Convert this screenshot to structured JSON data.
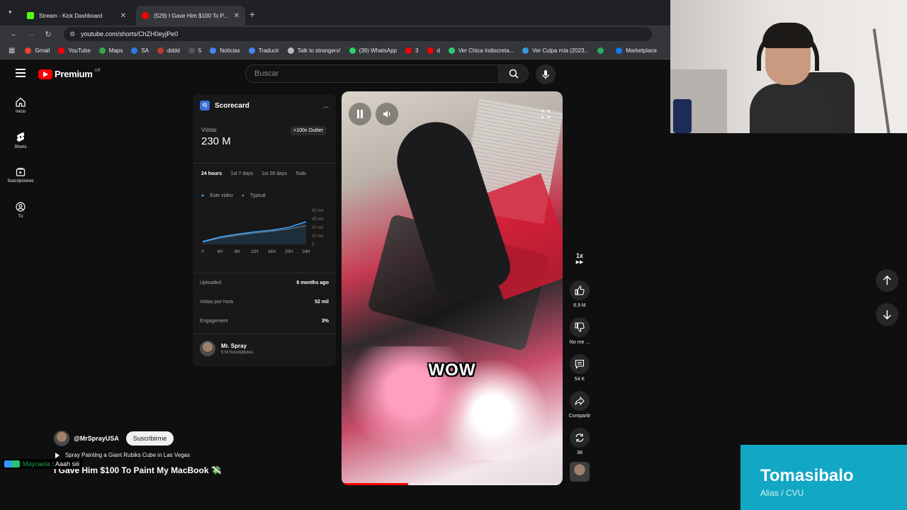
{
  "browser": {
    "tabs": [
      {
        "title": "Stream - Kick Dashboard",
        "favicon_color": "#53fc18",
        "active": false
      },
      {
        "title": "(529) I Gave Him $100 To P...",
        "favicon_color": "#ff0000",
        "active": true
      }
    ],
    "url": "youtube.com/shorts/ChZH0eyjPe0",
    "bookmarks": [
      {
        "label": "Gmail",
        "color": "#ea4335"
      },
      {
        "label": "YouTube",
        "color": "#ff0000"
      },
      {
        "label": "Maps",
        "color": "#34a853"
      },
      {
        "label": "SA",
        "color": "#2c7be5"
      },
      {
        "label": "dddd",
        "color": "#c0392b"
      },
      {
        "label": "5",
        "color": "#555555"
      },
      {
        "label": "Noticias",
        "color": "#4285f4"
      },
      {
        "label": "Traducir",
        "color": "#4285f4"
      },
      {
        "label": "Talk to strangers!",
        "color": "#bbbbbb"
      },
      {
        "label": "(39) WhatsApp",
        "color": "#25d366"
      },
      {
        "label": "3",
        "color": "#ff0000"
      },
      {
        "label": "d",
        "color": "#ff0000"
      },
      {
        "label": "Ver Chica Indiscreta...",
        "color": "#2ecc71"
      },
      {
        "label": "Ver Culpa mía (2023...",
        "color": "#3498db"
      },
      {
        "label": "",
        "color": "#27ae60"
      },
      {
        "label": "Marketplace",
        "color": "#1877f2"
      }
    ]
  },
  "youtube": {
    "logo_text": "Premium",
    "country_code": "AR",
    "search_placeholder": "Buscar",
    "rail": [
      {
        "label": "Inicio",
        "icon": "home-icon"
      },
      {
        "label": "Shorts",
        "icon": "shorts-icon"
      },
      {
        "label": "Suscripciones",
        "icon": "subscriptions-icon"
      },
      {
        "label": "Tú",
        "icon": "you-icon"
      }
    ]
  },
  "scorecard": {
    "badge": "IQ",
    "title": "Scorecard",
    "views_label": "Vistas",
    "views": "230 M",
    "outlier": ">100x Outlier",
    "ranges": [
      "24 hours",
      "1st 7 days",
      "1st 28 days",
      "Todo"
    ],
    "legend": [
      "Este video",
      "Typical"
    ],
    "chart_data": {
      "type": "line",
      "x": [
        "0",
        "4H",
        "8H",
        "12H",
        "16H",
        "20H",
        "24H"
      ],
      "y_ticks": [
        "60 mil",
        "45 mil",
        "30 mil",
        "15 mil",
        "0"
      ],
      "series": [
        {
          "name": "Este video",
          "values": [
            5,
            13,
            18,
            22,
            25,
            30,
            40
          ]
        },
        {
          "name": "Typical",
          "values": [
            4,
            11,
            16,
            20,
            23,
            27,
            33
          ]
        }
      ]
    },
    "rows": [
      {
        "label": "Uploaded",
        "value": "6 months ago"
      },
      {
        "label": "Vistas por hora",
        "value": "52 mil"
      },
      {
        "label": "Engagement",
        "value": "3%"
      }
    ],
    "channel_name": "Mr. Spray",
    "channel_subs": "5 M Suscriptores"
  },
  "video": {
    "caption": "WOW",
    "progress": 0.3
  },
  "actions": {
    "speed": "1x",
    "likes": "6,9 M",
    "dislike": "No me ...",
    "comments": "54 K",
    "share": "Compartir",
    "remix": "38"
  },
  "info": {
    "handle": "@MrSprayUSA",
    "subscribe": "Suscribirme",
    "related": "Spray Painting a Giant Rubiks Cube in Las Vegas",
    "title": "I Gave Him $100 To Paint My MacBook 💸"
  },
  "chat": {
    "user": "Maycaela",
    "message": ": Aaah siii"
  },
  "donation": {
    "name": "Tomasibalo",
    "alias": "Alias / CVU"
  }
}
